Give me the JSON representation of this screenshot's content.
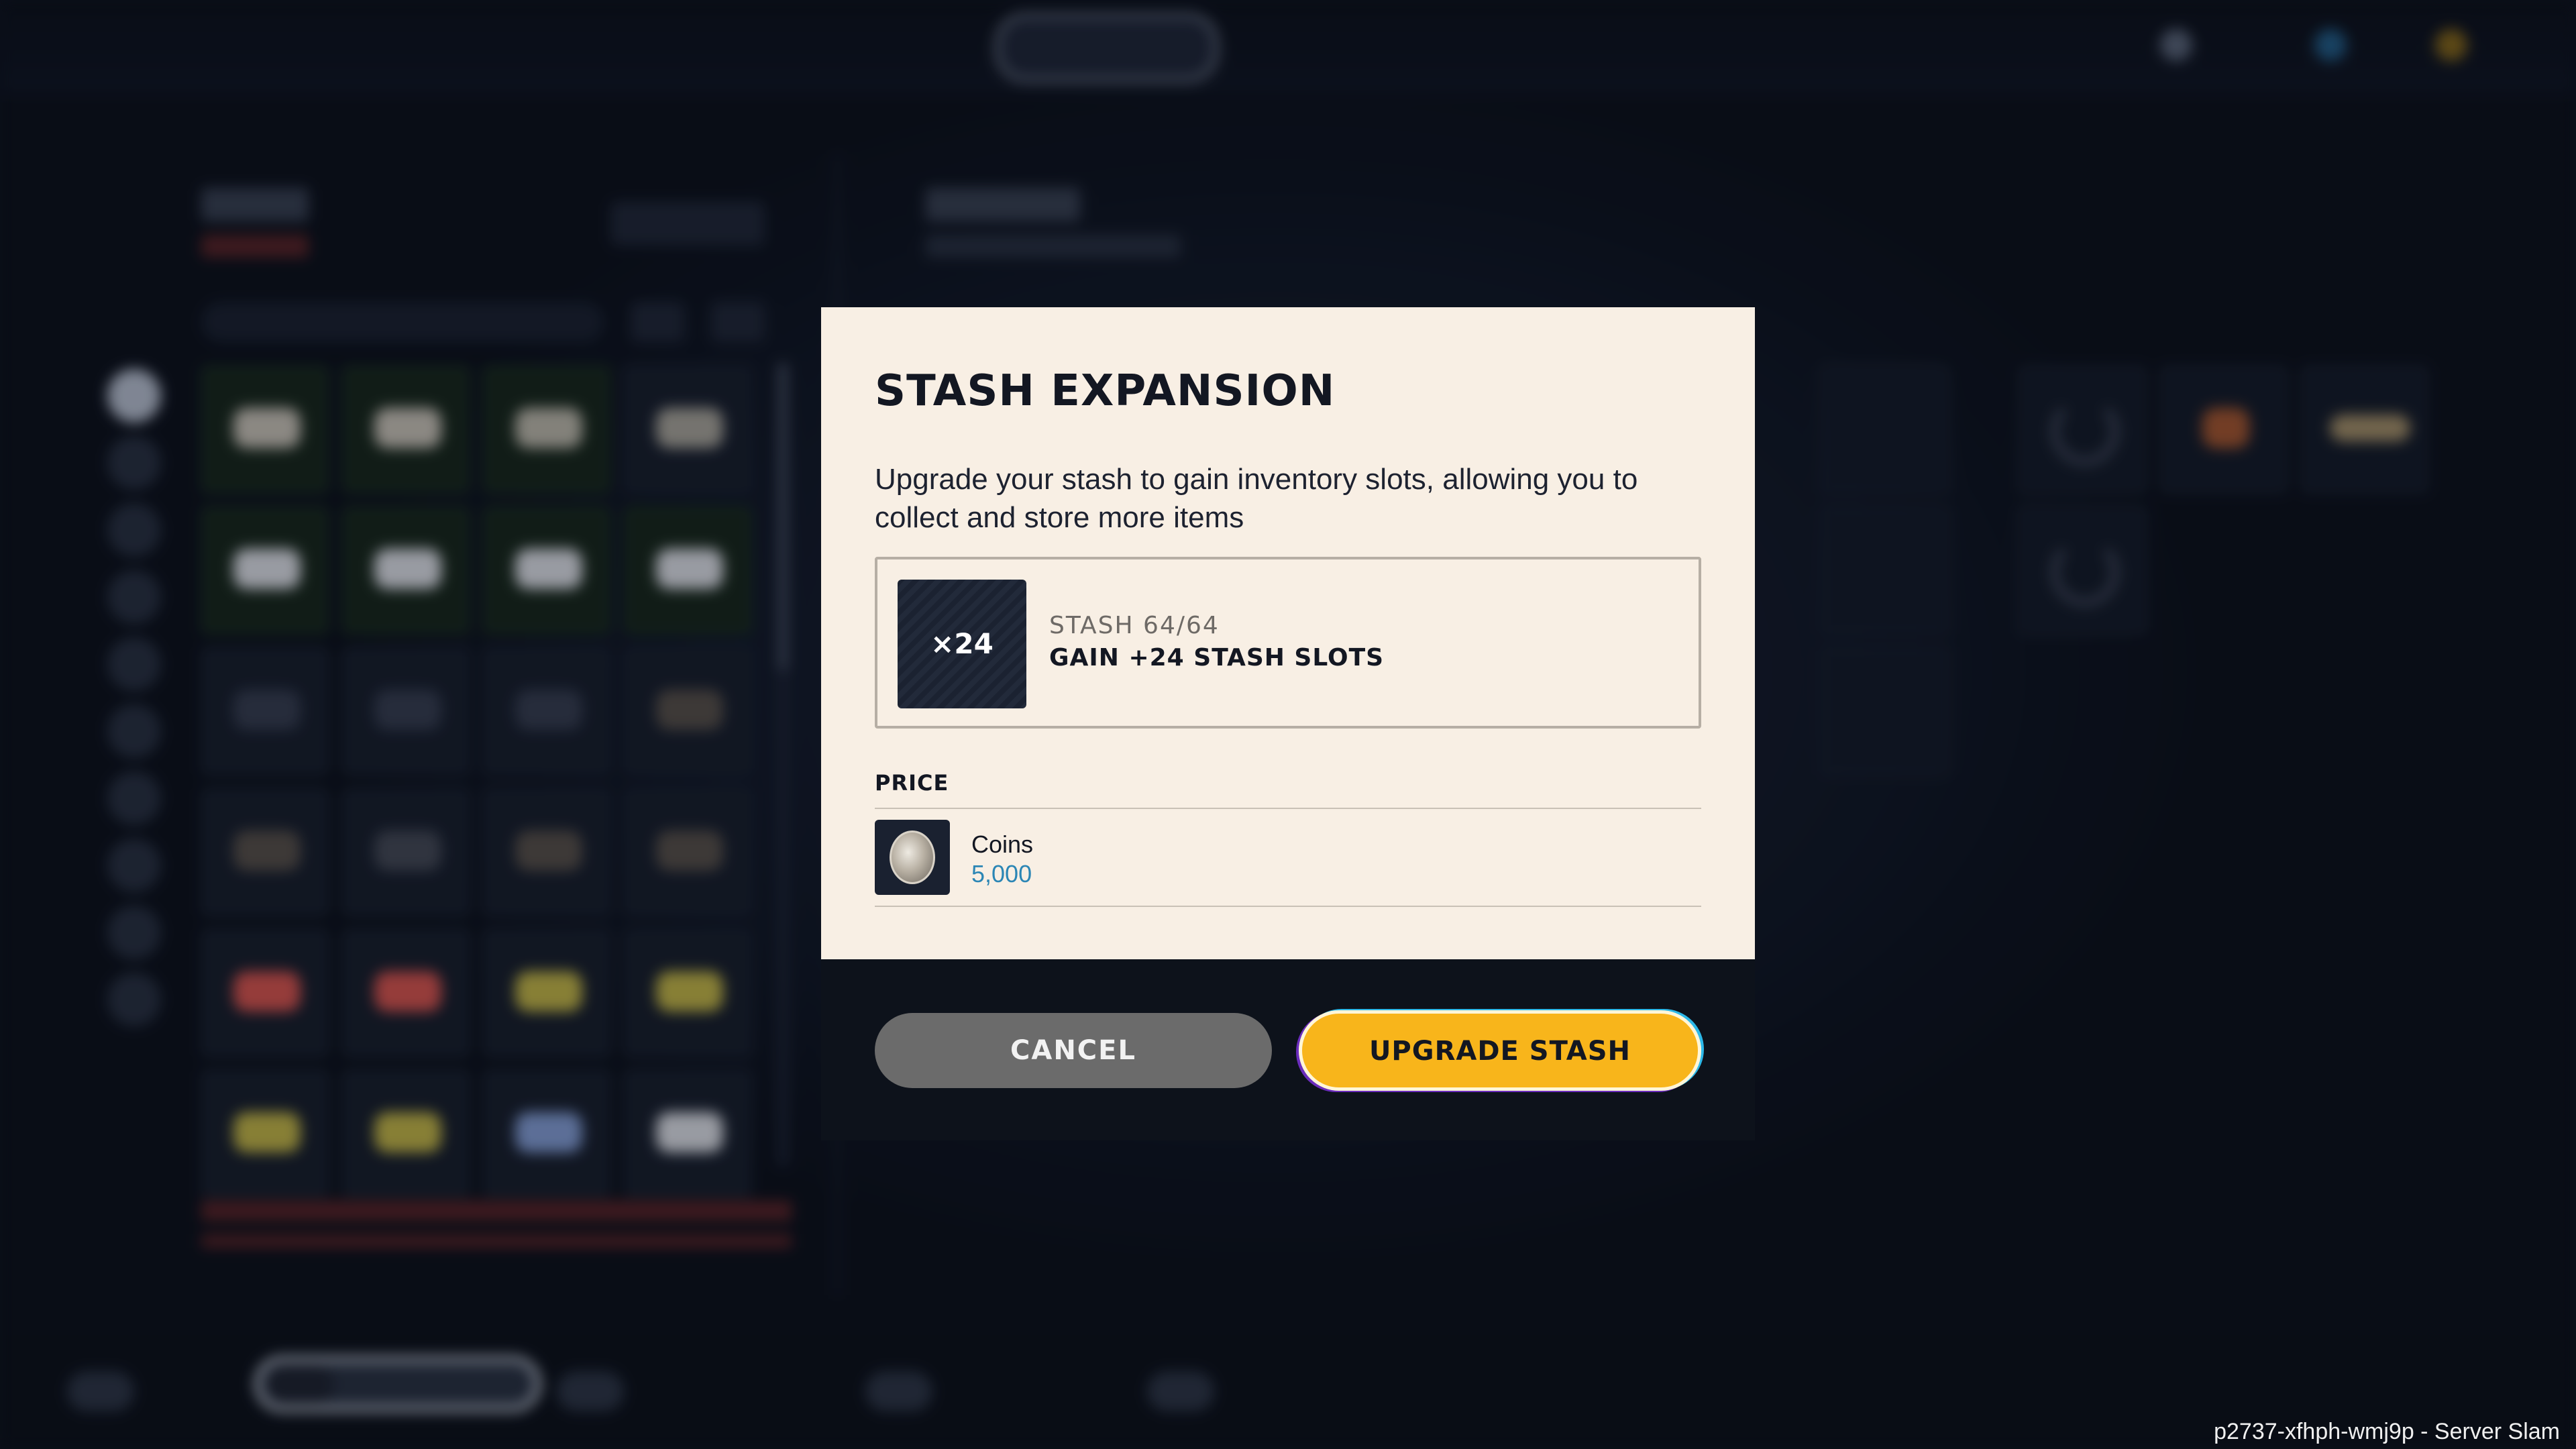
{
  "dialog": {
    "title": "STASH EXPANSION",
    "description": "Upgrade your stash to gain inventory slots, allowing you to collect and store more items",
    "offer": {
      "icon_label": "×24",
      "line1": "STASH 64/64",
      "line2": "GAIN +24 STASH SLOTS"
    },
    "price": {
      "label": "PRICE",
      "currency_name": "Coins",
      "amount": "5,000",
      "icon": "coin-icon"
    },
    "buttons": {
      "cancel": "CANCEL",
      "upgrade": "UPGRADE STASH"
    }
  },
  "colors": {
    "dialog_bg": "#f8efe4",
    "upgrade_button": "#f8b51b",
    "cancel_button": "#6b6b6b",
    "price_amount": "#2b86b5"
  },
  "watermark": "p2737-xfhph-wmj9p - Server Slam"
}
